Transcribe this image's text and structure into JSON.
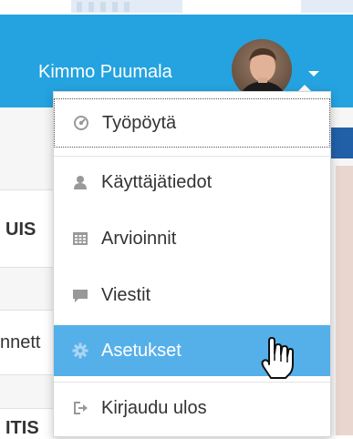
{
  "header": {
    "user_name": "Kimmo Puumala"
  },
  "background": {
    "left_label_1": "UIS",
    "left_label_2": "nnett",
    "left_label_3": "ITIS"
  },
  "menu": {
    "items": [
      {
        "label": "Työpöytä",
        "icon": "dashboard-icon"
      },
      {
        "label": "Käyttäjätiedot",
        "icon": "user-icon"
      },
      {
        "label": "Arvioinnit",
        "icon": "grid-icon"
      },
      {
        "label": "Viestit",
        "icon": "chat-icon"
      },
      {
        "label": "Asetukset",
        "icon": "gear-icon",
        "state": "hovered"
      },
      {
        "label": "Kirjaudu ulos",
        "icon": "logout-icon"
      }
    ]
  },
  "colors": {
    "header_bg": "#24a3e0",
    "active_bg": "#55b0ea",
    "text": "#333333"
  }
}
